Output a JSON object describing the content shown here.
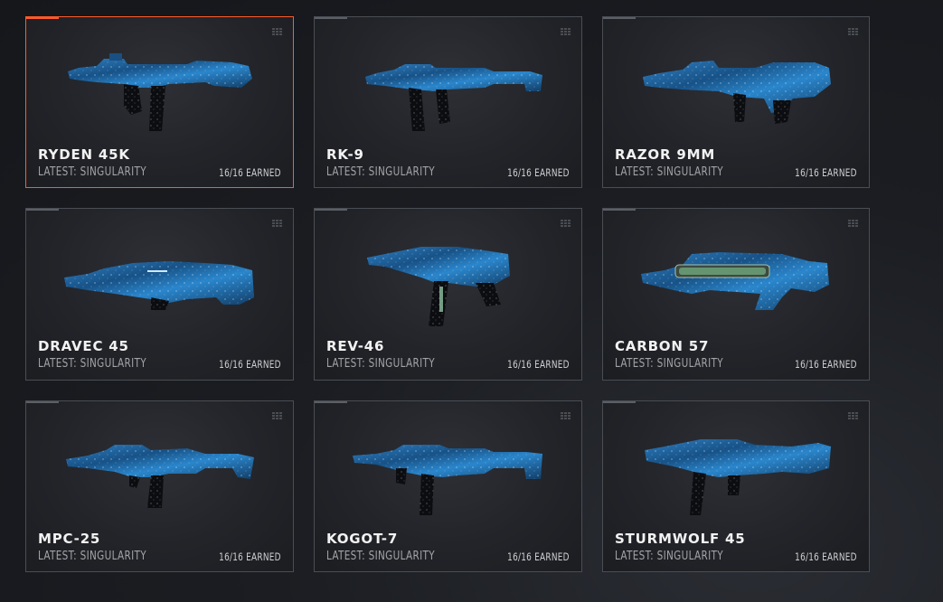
{
  "colors": {
    "selected_border": "#ff5a2a",
    "camo_blue": "#1f5f96",
    "camo_light": "#4aa3e0",
    "text_primary": "#f2f2f2",
    "text_secondary": "#a2a4a8"
  },
  "weapons": [
    {
      "name": "RYDEN 45K",
      "latest": "LATEST: SINGULARITY",
      "earned": "16/16 EARNED",
      "selected": true
    },
    {
      "name": "RK-9",
      "latest": "LATEST: SINGULARITY",
      "earned": "16/16 EARNED",
      "selected": false
    },
    {
      "name": "RAZOR 9MM",
      "latest": "LATEST: SINGULARITY",
      "earned": "16/16 EARNED",
      "selected": false
    },
    {
      "name": "DRAVEC 45",
      "latest": "LATEST: SINGULARITY",
      "earned": "16/16 EARNED",
      "selected": false
    },
    {
      "name": "REV-46",
      "latest": "LATEST: SINGULARITY",
      "earned": "16/16 EARNED",
      "selected": false
    },
    {
      "name": "CARBON 57",
      "latest": "LATEST: SINGULARITY",
      "earned": "16/16 EARNED",
      "selected": false
    },
    {
      "name": "MPC-25",
      "latest": "LATEST: SINGULARITY",
      "earned": "16/16 EARNED",
      "selected": false
    },
    {
      "name": "KOGOT-7",
      "latest": "LATEST: SINGULARITY",
      "earned": "16/16 EARNED",
      "selected": false
    },
    {
      "name": "STURMWOLF 45",
      "latest": "LATEST: SINGULARITY",
      "earned": "16/16 EARNED",
      "selected": false
    }
  ]
}
